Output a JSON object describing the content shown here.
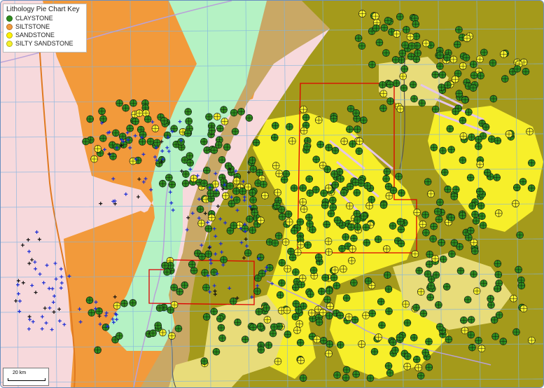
{
  "legend": {
    "title": "Lithology Pie Chart Key",
    "items": [
      {
        "label": "CLAYSTONE",
        "color": "#2e8b1e"
      },
      {
        "label": "SILTSTONE",
        "color": "#f29a3b"
      },
      {
        "label": "SANDSTONE",
        "color": "#fff200"
      },
      {
        "label": "SILTY SANDSTONE",
        "color": "#f5f02a"
      }
    ]
  },
  "scale": {
    "label": "20 km"
  },
  "colors": {
    "background": "#f7d9dc",
    "siltstone_zone": "#f29a3b",
    "light_green_zone": "#b5f2c4",
    "khaki_zone": "#c9a865",
    "olive_zone": "#a49a1b",
    "yellow_zone": "#f7ef2a",
    "pale_yellow_zone": "#e8dc7a",
    "grid_lines": "#7fb3e0",
    "study_area_outline": "#dd0000",
    "pie_claystone": "#2e8b1e",
    "well_marker": "#1a2bd4",
    "river": "#e07a20",
    "road": "#b9a2d8"
  }
}
